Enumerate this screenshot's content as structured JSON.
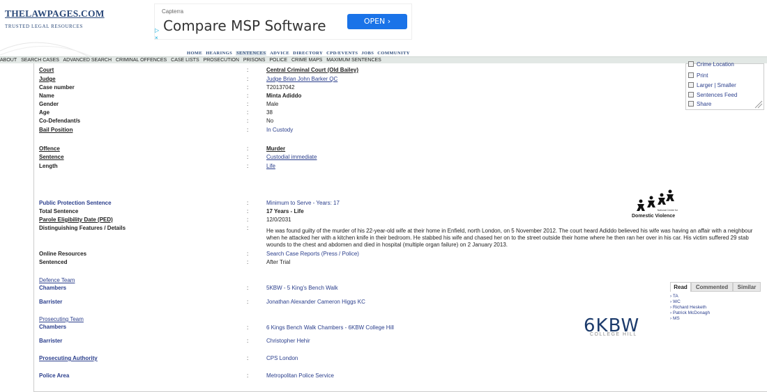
{
  "site": {
    "title": "THELAWPAGES.COM",
    "tagline": "TRUSTED   LEGAL   RESOURCES"
  },
  "ad": {
    "brand": "Capterra",
    "title": "Compare MSP Software",
    "button": "OPEN ›",
    "play": "▷",
    "close": "×",
    "accent": "#1a73e8"
  },
  "topnav": [
    "HOME",
    "HEARINGS",
    "SENTENCES",
    "ADVICE",
    "DIRECTORY",
    "CPD/EVENTS",
    "JOBS",
    "COMMUNITY"
  ],
  "subnav": [
    "ABOUT",
    "SEARCH CASES",
    "ADVANCED SEARCH",
    "CRIMINAL OFFENCES",
    "CASE LISTS",
    "PROSECUTION",
    "PRISONS",
    "POLICE",
    "CRIME MAPS",
    "MAXIMUM SENTENCES"
  ],
  "case": {
    "court_label": "Court",
    "court": "Central Criminal Court (Old Bailey)",
    "judge_label": "Judge",
    "judge": "Judge Brian John Barker QC",
    "case_number_label": "Case number",
    "case_number": "T20137042",
    "name_label": "Name",
    "name": "Minta Adiddo",
    "gender_label": "Gender",
    "gender": "Male",
    "age_label": "Age",
    "age": "38",
    "codef_label": "Co-Defendant/s",
    "codef": "No",
    "bail_label": "Bail Position",
    "bail": "In Custody",
    "offence_label": "Offence",
    "offence": "Murder",
    "sentence_label": "Sentence",
    "sentence": "Custodial immediate",
    "length_label": "Length",
    "length": "Life",
    "pps_label": "Public Protection Sentence",
    "pps": "Minimum to Serve - Years: 17",
    "total_label": "Total Sentence",
    "total": "17 Years - Life",
    "ped_label": "Parole Eligibility Date (PED)",
    "ped": "12/0/2031",
    "dist_label": "Distinguishing Features / Details",
    "details": "He was found guilty of the murder of his 22-year-old wife at their home in Enfield, north London, on 5 November 2012. The court heard Adiddo believed his wife was having an affair with a neighbour when he attacked her with a kitchen knife in their bedroom. He stabbed his wife and chased her on to the street outside their home where he then ran her over in his car. His victim suffered 29 stab wounds to the chest and abdomen and died in hospital (multiple organ failure) on 2 January 2013.",
    "online_label": "Online Resources",
    "online": "Search Case Reports (Press / Police)",
    "sentenced_label": "Sentenced",
    "sentenced": "After Trial",
    "defence_team_label": "Defence Team",
    "def_chambers_label": "Chambers",
    "def_chambers": "5KBW - 5 King's Bench Walk",
    "def_barrister_label": "Barrister",
    "def_barrister": "Jonathan Alexander Cameron Higgs KC",
    "prosecuting_team_label": "Prosecuting Team",
    "pros_chambers_label": "Chambers",
    "pros_chambers": "6 Kings Bench Walk Chambers - 6KBW College Hill",
    "pros_barrister_label": "Barrister",
    "pros_barrister": "Christopher Hehir",
    "authority_label": "Prosecuting Authority",
    "authority": "CPS London",
    "police_label": "Police Area",
    "police": "Metropolitan Police Service",
    "colon": ":"
  },
  "sidebar": {
    "items": [
      "Crime Location",
      "Print",
      "Larger | Smaller",
      "Sentences Feed",
      "Share"
    ]
  },
  "dv": {
    "small": "National Centre for",
    "label": "Domestic Violence"
  },
  "kbw": {
    "logo": "6KBW",
    "sub": "COLLEGE HILL"
  },
  "readtabs": {
    "tabs": [
      "Read",
      "Commented",
      "Similar"
    ],
    "items": [
      "› TA",
      "› WC",
      "› Richard Hesketh",
      "› Patrick McDonagh",
      "› MS"
    ]
  }
}
